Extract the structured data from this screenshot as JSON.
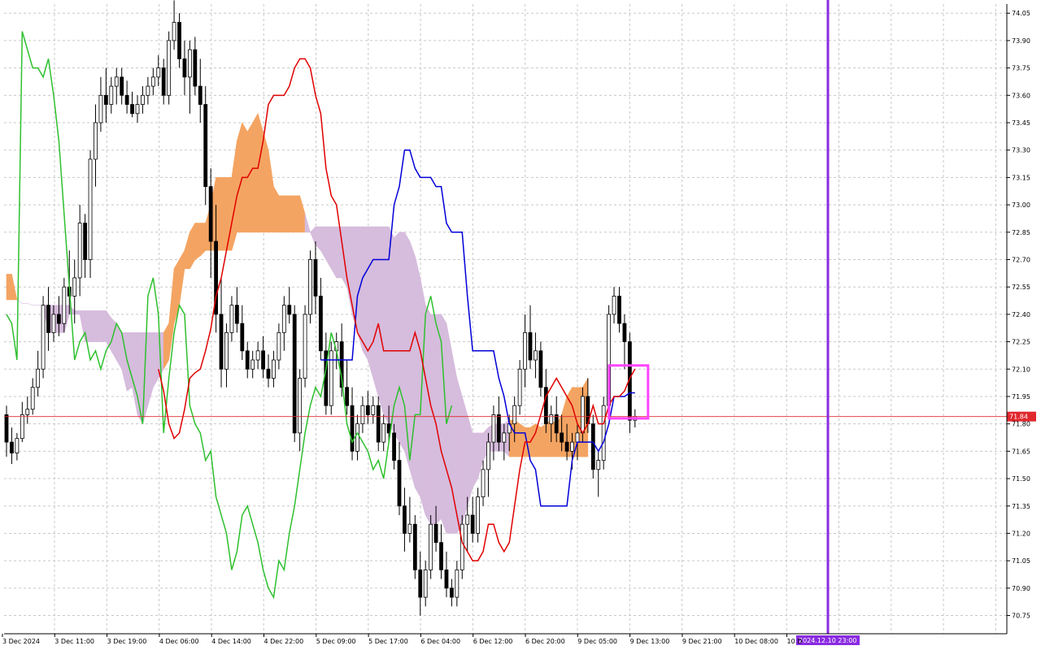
{
  "chart_data": {
    "type": "candlestick",
    "indicator": "ichimoku",
    "y_axis": {
      "min": 70.65,
      "max": 74.1,
      "ticks": [
        "74.05",
        "73.90",
        "73.75",
        "73.60",
        "73.45",
        "73.30",
        "73.15",
        "73.00",
        "72.85",
        "72.70",
        "72.55",
        "72.40",
        "72.25",
        "72.10",
        "71.95",
        "71.80",
        "71.65",
        "71.50",
        "71.35",
        "71.20",
        "71.05",
        "70.90",
        "70.75"
      ]
    },
    "x_axis": {
      "labels": [
        "3 Dec 2024",
        "3 Dec 11:00",
        "3 Dec 19:00",
        "4 Dec 06:00",
        "4 Dec 14:00",
        "4 Dec 22:00",
        "5 Dec 09:00",
        "5 Dec 17:00",
        "6 Dec 04:00",
        "6 Dec 12:00",
        "6 Dec 20:00",
        "9 Dec 05:00",
        "9 Dec 13:00",
        "9 Dec 21:00",
        "10 Dec 08:00",
        "10 D"
      ]
    },
    "grid": true,
    "current_price": {
      "value": 71.84,
      "label": "71.84",
      "color": "#e0282d"
    },
    "cursor_time": {
      "label": "2024.12.10 23:00",
      "color": "#8a2be2"
    },
    "colors": {
      "tenkan": "#e00000",
      "kijun": "#0000d8",
      "chikou": "#2ec02e",
      "cloud_bull": "#f4a462",
      "cloud_bear": "#d6bcdd",
      "marker": "#ff44ff",
      "candle_up_body": "#ffffff",
      "candle_down_body": "#000000"
    },
    "candles": [
      [
        71.85,
        71.9,
        71.62,
        71.7
      ],
      [
        71.7,
        71.78,
        71.58,
        71.64
      ],
      [
        71.64,
        71.75,
        71.6,
        71.72
      ],
      [
        71.72,
        71.92,
        71.7,
        71.85
      ],
      [
        71.85,
        71.95,
        71.8,
        71.88
      ],
      [
        71.88,
        72.05,
        71.85,
        72.0
      ],
      [
        72.0,
        72.2,
        71.95,
        72.1
      ],
      [
        72.1,
        72.5,
        72.05,
        72.45
      ],
      [
        72.45,
        72.55,
        72.2,
        72.3
      ],
      [
        72.3,
        72.45,
        72.25,
        72.4
      ],
      [
        72.4,
        72.5,
        72.28,
        72.35
      ],
      [
        72.35,
        72.6,
        72.3,
        72.55
      ],
      [
        72.55,
        72.75,
        72.4,
        72.5
      ],
      [
        72.5,
        72.7,
        72.35,
        72.6
      ],
      [
        72.6,
        73.0,
        72.5,
        72.9
      ],
      [
        72.9,
        72.95,
        72.6,
        72.7
      ],
      [
        72.7,
        73.3,
        72.6,
        73.25
      ],
      [
        73.25,
        73.55,
        73.1,
        73.45
      ],
      [
        73.45,
        73.7,
        73.4,
        73.6
      ],
      [
        73.6,
        73.75,
        73.45,
        73.55
      ],
      [
        73.55,
        73.7,
        73.5,
        73.65
      ],
      [
        73.65,
        73.75,
        73.55,
        73.7
      ],
      [
        73.7,
        73.75,
        73.55,
        73.6
      ],
      [
        73.6,
        73.68,
        73.5,
        73.55
      ],
      [
        73.55,
        73.62,
        73.48,
        73.5
      ],
      [
        73.5,
        73.6,
        73.45,
        73.55
      ],
      [
        73.55,
        73.65,
        73.5,
        73.6
      ],
      [
        73.6,
        73.7,
        73.55,
        73.65
      ],
      [
        73.65,
        73.75,
        73.6,
        73.7
      ],
      [
        73.7,
        73.82,
        73.65,
        73.75
      ],
      [
        73.75,
        73.8,
        73.55,
        73.6
      ],
      [
        73.6,
        73.95,
        73.55,
        73.9
      ],
      [
        73.9,
        74.12,
        73.85,
        74.0
      ],
      [
        74.0,
        74.05,
        73.75,
        73.8
      ],
      [
        73.8,
        73.9,
        73.6,
        73.7
      ],
      [
        73.7,
        73.9,
        73.5,
        73.85
      ],
      [
        73.85,
        73.92,
        73.6,
        73.65
      ],
      [
        73.65,
        73.8,
        73.45,
        73.55
      ],
      [
        73.55,
        73.65,
        73.0,
        73.1
      ],
      [
        73.1,
        73.2,
        72.6,
        72.8
      ],
      [
        72.8,
        73.0,
        72.3,
        72.4
      ],
      [
        72.4,
        72.6,
        72.0,
        72.1
      ],
      [
        72.1,
        72.35,
        72.0,
        72.3
      ],
      [
        72.3,
        72.5,
        72.25,
        72.45
      ],
      [
        72.45,
        72.55,
        72.3,
        72.35
      ],
      [
        72.35,
        72.45,
        72.15,
        72.2
      ],
      [
        72.2,
        72.25,
        72.05,
        72.1
      ],
      [
        72.1,
        72.2,
        72.05,
        72.15
      ],
      [
        72.15,
        72.25,
        72.1,
        72.2
      ],
      [
        72.2,
        72.28,
        72.05,
        72.1
      ],
      [
        72.1,
        72.18,
        72.0,
        72.05
      ],
      [
        72.05,
        72.2,
        72.0,
        72.15
      ],
      [
        72.15,
        72.35,
        72.1,
        72.3
      ],
      [
        72.3,
        72.5,
        72.2,
        72.45
      ],
      [
        72.45,
        72.55,
        72.35,
        72.4
      ],
      [
        72.4,
        72.45,
        71.7,
        71.75
      ],
      [
        71.75,
        72.1,
        71.65,
        72.05
      ],
      [
        72.05,
        72.45,
        72.0,
        72.4
      ],
      [
        72.4,
        72.75,
        72.35,
        72.7
      ],
      [
        72.7,
        72.8,
        72.4,
        72.5
      ],
      [
        72.5,
        72.6,
        72.15,
        72.2
      ],
      [
        72.2,
        72.3,
        71.85,
        71.9
      ],
      [
        71.9,
        72.25,
        71.85,
        72.2
      ],
      [
        72.2,
        72.3,
        72.1,
        72.25
      ],
      [
        72.25,
        72.35,
        71.95,
        72.0
      ],
      [
        72.0,
        72.15,
        71.85,
        71.9
      ],
      [
        71.9,
        72.0,
        71.6,
        71.65
      ],
      [
        71.65,
        71.85,
        71.6,
        71.8
      ],
      [
        71.8,
        71.95,
        71.75,
        71.9
      ],
      [
        71.9,
        71.98,
        71.8,
        71.85
      ],
      [
        71.85,
        71.95,
        71.8,
        71.9
      ],
      [
        71.9,
        71.95,
        71.65,
        71.7
      ],
      [
        71.7,
        71.85,
        71.65,
        71.8
      ],
      [
        71.8,
        71.9,
        71.7,
        71.75
      ],
      [
        71.75,
        71.8,
        71.55,
        71.6
      ],
      [
        71.6,
        71.7,
        71.3,
        71.35
      ],
      [
        71.35,
        71.45,
        71.1,
        71.2
      ],
      [
        71.2,
        71.4,
        71.15,
        71.25
      ],
      [
        71.25,
        71.3,
        70.95,
        71.0
      ],
      [
        71.0,
        71.1,
        70.75,
        70.85
      ],
      [
        70.85,
        71.05,
        70.8,
        71.0
      ],
      [
        71.0,
        71.3,
        70.95,
        71.25
      ],
      [
        71.25,
        71.35,
        71.1,
        71.15
      ],
      [
        71.15,
        71.25,
        70.95,
        71.0
      ],
      [
        71.0,
        71.1,
        70.85,
        70.9
      ],
      [
        70.9,
        70.95,
        70.8,
        70.85
      ],
      [
        70.85,
        71.05,
        70.8,
        71.0
      ],
      [
        71.0,
        71.3,
        70.95,
        71.25
      ],
      [
        71.25,
        71.4,
        71.1,
        71.3
      ],
      [
        71.3,
        71.4,
        71.15,
        71.2
      ],
      [
        71.2,
        71.45,
        71.15,
        71.4
      ],
      [
        71.4,
        71.6,
        71.35,
        71.55
      ],
      [
        71.55,
        71.75,
        71.4,
        71.7
      ],
      [
        71.7,
        71.9,
        71.6,
        71.85
      ],
      [
        71.85,
        71.95,
        71.65,
        71.7
      ],
      [
        71.7,
        71.8,
        71.6,
        71.75
      ],
      [
        71.75,
        71.85,
        71.65,
        71.8
      ],
      [
        71.8,
        71.95,
        71.7,
        71.9
      ],
      [
        71.9,
        72.15,
        71.85,
        72.1
      ],
      [
        72.1,
        72.4,
        72.0,
        72.3
      ],
      [
        72.3,
        72.45,
        72.1,
        72.15
      ],
      [
        72.15,
        72.3,
        72.05,
        72.2
      ],
      [
        72.2,
        72.25,
        71.95,
        72.0
      ],
      [
        72.0,
        72.1,
        71.75,
        71.8
      ],
      [
        71.8,
        71.9,
        71.7,
        71.85
      ],
      [
        71.85,
        71.95,
        71.7,
        71.75
      ],
      [
        71.75,
        71.85,
        71.65,
        71.7
      ],
      [
        71.7,
        71.8,
        71.6,
        71.65
      ],
      [
        71.65,
        71.75,
        71.55,
        71.7
      ],
      [
        71.7,
        71.8,
        71.6,
        71.75
      ],
      [
        71.75,
        72.0,
        71.7,
        71.95
      ],
      [
        71.95,
        72.05,
        71.75,
        71.8
      ],
      [
        71.8,
        71.85,
        71.5,
        71.55
      ],
      [
        71.55,
        71.65,
        71.4,
        71.6
      ],
      [
        71.6,
        71.95,
        71.55,
        71.9
      ],
      [
        71.9,
        72.45,
        71.85,
        72.4
      ],
      [
        72.4,
        72.55,
        72.35,
        72.5
      ],
      [
        72.5,
        72.55,
        72.3,
        72.35
      ],
      [
        72.35,
        72.4,
        72.1,
        72.25
      ],
      [
        72.25,
        72.3,
        71.75,
        71.82
      ],
      [
        71.82,
        71.88,
        71.78,
        71.84
      ]
    ],
    "tenkan": [
      72.1,
      71.98,
      71.8,
      71.72,
      71.75,
      71.88,
      72.05,
      72.08,
      72.1,
      72.2,
      72.32,
      72.5,
      72.6,
      72.75,
      72.9,
      73.05,
      73.15,
      73.15,
      73.2,
      73.2,
      73.35,
      73.55,
      73.6,
      73.6,
      73.6,
      73.65,
      73.75,
      73.8,
      73.8,
      73.75,
      73.6,
      73.5,
      73.2,
      73.05,
      73.0,
      72.8,
      72.6,
      72.45,
      72.3,
      72.25,
      72.2,
      72.25,
      72.35,
      72.2,
      72.2,
      72.2,
      72.2,
      72.2,
      72.2,
      72.3,
      72.2,
      72.05,
      71.9,
      71.8,
      71.65,
      71.55,
      71.45,
      71.3,
      71.15,
      71.1,
      71.05,
      71.05,
      71.1,
      71.25,
      71.25,
      71.15,
      71.1,
      71.15,
      71.35,
      71.55,
      71.7,
      71.7,
      71.75,
      71.85,
      71.95,
      72.0,
      72.05,
      72.0,
      71.95,
      71.9,
      71.8,
      71.75,
      71.8,
      71.9,
      71.8,
      71.8,
      71.9,
      71.95,
      71.95,
      71.98,
      72.05,
      72.1
    ],
    "kijun": [
      72.15,
      72.15,
      72.15,
      72.15,
      72.15,
      72.15,
      72.15,
      72.5,
      72.6,
      72.65,
      72.7,
      72.7,
      72.7,
      72.7,
      73.0,
      73.1,
      73.3,
      73.3,
      73.2,
      73.15,
      73.15,
      73.15,
      73.1,
      73.1,
      72.9,
      72.85,
      72.85,
      72.85,
      72.5,
      72.2,
      72.2,
      72.2,
      72.2,
      72.2,
      72.05,
      71.95,
      71.8,
      71.75,
      71.75,
      71.75,
      71.6,
      71.55,
      71.35,
      71.35,
      71.35,
      71.35,
      71.35,
      71.35,
      71.6,
      71.7,
      71.7,
      71.7,
      71.7,
      71.65,
      71.7,
      71.8,
      71.95,
      71.95,
      71.95,
      71.97,
      71.97
    ],
    "chikou": [
      72.4,
      72.35,
      72.15,
      73.95,
      73.85,
      73.75,
      73.75,
      73.7,
      73.8,
      73.6,
      73.35,
      72.95,
      72.55,
      72.15,
      72.25,
      72.3,
      72.15,
      72.2,
      72.1,
      72.2,
      72.25,
      72.35,
      72.3,
      72.15,
      72.05,
      71.95,
      71.8,
      72.5,
      72.6,
      72.4,
      71.75,
      72.05,
      72.3,
      72.45,
      72.4,
      71.9,
      71.8,
      71.75,
      71.6,
      71.65,
      71.4,
      71.3,
      71.2,
      71.0,
      71.1,
      71.3,
      71.35,
      71.25,
      71.15,
      71.0,
      70.9,
      70.85,
      71.05,
      71.0,
      71.2,
      71.35,
      71.55,
      71.75,
      71.9,
      72.0,
      71.95,
      72.1,
      72.3,
      72.2,
      72.05,
      71.8,
      71.7,
      71.75,
      71.7,
      71.65,
      71.55,
      71.6,
      71.5,
      71.7,
      71.9,
      72.0,
      71.9,
      71.6,
      71.85,
      71.85,
      72.4,
      72.5,
      72.35,
      72.25,
      71.8,
      71.9
    ],
    "cloud": [
      [
        72.62,
        72.48
      ],
      [
        72.62,
        72.48
      ],
      [
        72.48,
        72.48
      ],
      [
        72.46,
        72.46
      ],
      [
        72.46,
        72.46
      ],
      [
        72.45,
        72.45
      ],
      [
        72.45,
        72.45
      ],
      [
        72.45,
        72.45
      ],
      [
        72.45,
        72.3
      ],
      [
        72.45,
        72.3
      ],
      [
        72.45,
        72.3
      ],
      [
        72.45,
        72.3
      ],
      [
        72.45,
        72.4
      ],
      [
        72.42,
        72.4
      ],
      [
        72.42,
        72.4
      ],
      [
        72.42,
        72.25
      ],
      [
        72.42,
        72.25
      ],
      [
        72.42,
        72.25
      ],
      [
        72.42,
        72.25
      ],
      [
        72.42,
        72.25
      ],
      [
        72.38,
        72.2
      ],
      [
        72.35,
        72.15
      ],
      [
        72.3,
        72.1
      ],
      [
        72.3,
        71.98
      ],
      [
        72.3,
        72.0
      ],
      [
        72.3,
        71.85
      ],
      [
        72.3,
        71.8
      ],
      [
        72.3,
        71.9
      ],
      [
        72.3,
        72.0
      ],
      [
        72.3,
        72.05
      ],
      [
        72.3,
        72.1
      ],
      [
        72.35,
        72.15
      ],
      [
        72.65,
        72.35
      ],
      [
        72.7,
        72.45
      ],
      [
        72.75,
        72.65
      ],
      [
        72.85,
        72.65
      ],
      [
        72.9,
        72.7
      ],
      [
        72.9,
        72.72
      ],
      [
        72.9,
        72.75
      ],
      [
        73.0,
        72.75
      ],
      [
        73.15,
        72.75
      ],
      [
        73.15,
        72.75
      ],
      [
        73.15,
        72.75
      ],
      [
        73.15,
        72.75
      ],
      [
        73.35,
        72.85
      ],
      [
        73.45,
        72.85
      ],
      [
        73.4,
        72.85
      ],
      [
        73.45,
        72.85
      ],
      [
        73.5,
        72.85
      ],
      [
        73.4,
        72.85
      ],
      [
        73.3,
        72.85
      ],
      [
        73.1,
        72.85
      ],
      [
        73.05,
        72.85
      ],
      [
        73.05,
        72.85
      ],
      [
        73.05,
        72.85
      ],
      [
        73.05,
        72.85
      ],
      [
        73.05,
        72.85
      ],
      [
        72.95,
        72.85
      ],
      [
        72.85,
        72.85
      ],
      [
        72.88,
        72.78
      ],
      [
        72.88,
        72.75
      ],
      [
        72.88,
        72.7
      ],
      [
        72.88,
        72.65
      ],
      [
        72.88,
        72.6
      ],
      [
        72.88,
        72.6
      ],
      [
        72.88,
        72.55
      ],
      [
        72.88,
        72.4
      ],
      [
        72.88,
        72.3
      ],
      [
        72.88,
        72.2
      ],
      [
        72.88,
        72.15
      ],
      [
        72.88,
        72.05
      ],
      [
        72.88,
        71.95
      ],
      [
        72.88,
        71.85
      ],
      [
        72.88,
        71.8
      ],
      [
        72.82,
        71.75
      ],
      [
        72.85,
        71.7
      ],
      [
        72.85,
        71.65
      ],
      [
        72.8,
        71.55
      ],
      [
        72.72,
        71.45
      ],
      [
        72.6,
        71.4
      ],
      [
        72.45,
        71.3
      ],
      [
        72.4,
        71.25
      ],
      [
        72.4,
        71.25
      ],
      [
        72.4,
        71.28
      ],
      [
        72.35,
        71.2
      ],
      [
        72.2,
        71.2
      ],
      [
        72.05,
        71.2
      ],
      [
        71.95,
        71.25
      ],
      [
        71.85,
        71.35
      ],
      [
        71.75,
        71.45
      ],
      [
        71.75,
        71.5
      ],
      [
        71.75,
        71.6
      ],
      [
        71.78,
        71.65
      ],
      [
        71.8,
        71.65
      ],
      [
        71.8,
        71.65
      ],
      [
        71.8,
        71.65
      ],
      [
        71.82,
        71.62
      ],
      [
        71.82,
        71.62
      ],
      [
        71.8,
        71.62
      ],
      [
        71.78,
        71.62
      ],
      [
        71.78,
        71.62
      ],
      [
        71.8,
        71.62
      ],
      [
        71.78,
        71.62
      ],
      [
        71.8,
        71.62
      ],
      [
        71.82,
        71.62
      ],
      [
        71.8,
        71.62
      ],
      [
        71.85,
        71.62
      ],
      [
        71.95,
        71.62
      ],
      [
        72.0,
        71.62
      ],
      [
        72.0,
        71.62
      ],
      [
        72.0,
        71.62
      ],
      [
        72.05,
        71.62
      ]
    ]
  }
}
